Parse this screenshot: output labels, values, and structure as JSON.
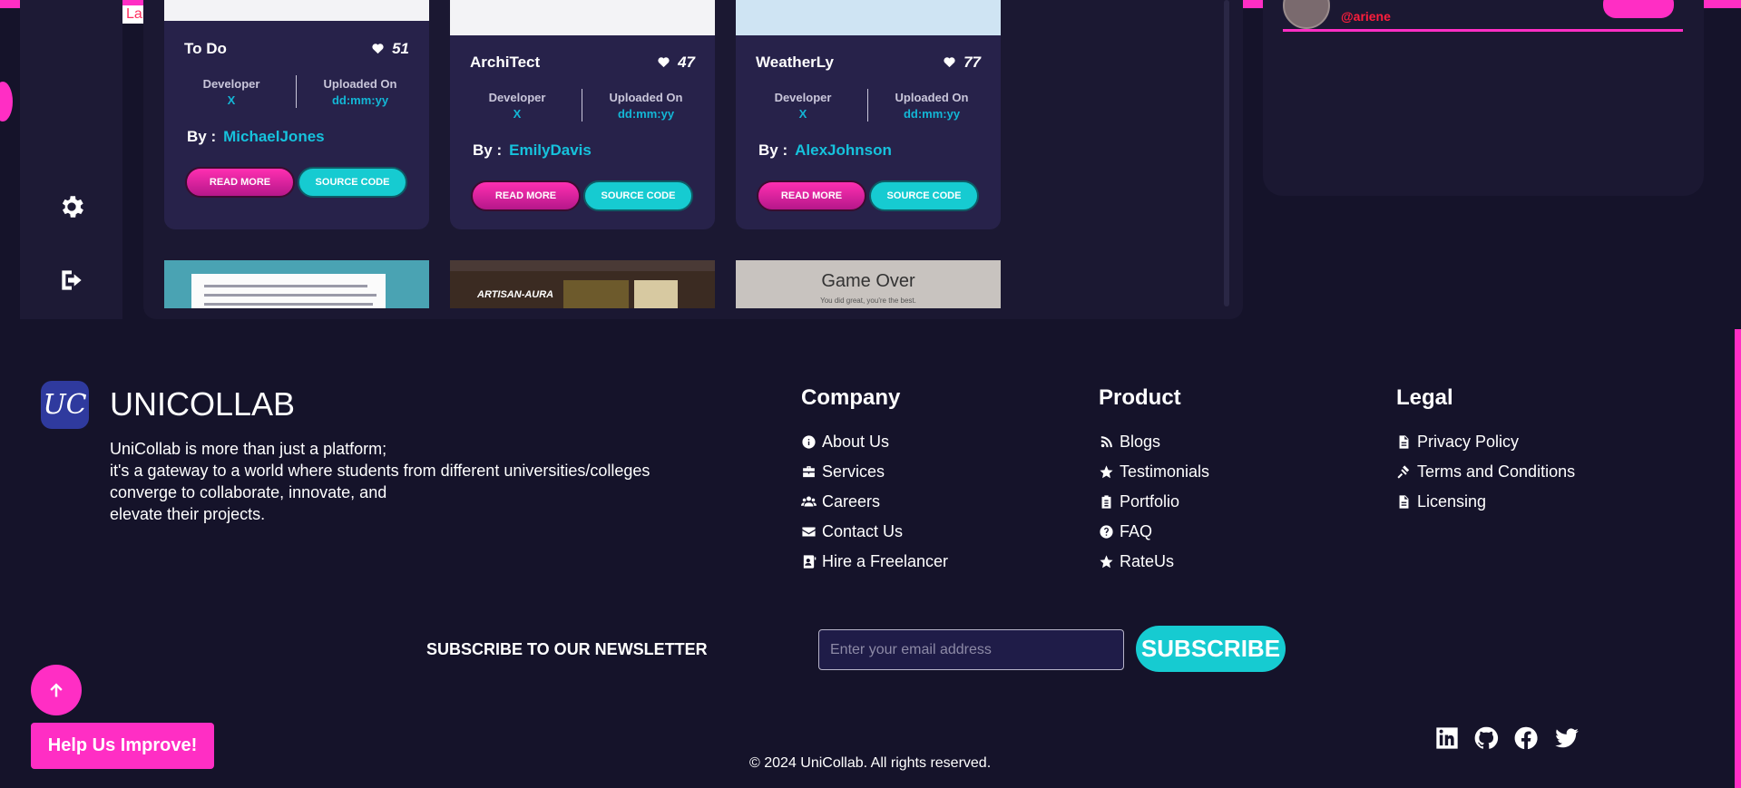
{
  "sidebar": {
    "logo_fragment": "Lar",
    "settings_icon": "gear-icon",
    "logout_icon": "logout-icon"
  },
  "cards": [
    {
      "title": "To Do",
      "likes": "51",
      "dev_label": "Developer",
      "dev_value": "X",
      "upload_label": "Uploaded On",
      "upload_value": "dd:mm:yy",
      "by_label": "By :",
      "author": "MichaelJones",
      "read_more": "READ MORE",
      "source_code": "SOURCE CODE"
    },
    {
      "title": "ArchiTect",
      "likes": "47",
      "dev_label": "Developer",
      "dev_value": "X",
      "upload_label": "Uploaded On",
      "upload_value": "dd:mm:yy",
      "by_label": "By :",
      "author": "EmilyDavis",
      "read_more": "READ MORE",
      "source_code": "SOURCE CODE"
    },
    {
      "title": "WeatherLy",
      "likes": "77",
      "dev_label": "Developer",
      "dev_value": "X",
      "upload_label": "Uploaded On",
      "upload_value": "dd:mm:yy",
      "by_label": "By :",
      "author": "AlexJohnson",
      "read_more": "READ MORE",
      "source_code": "SOURCE CODE"
    }
  ],
  "thumbnails": {
    "second_title": "ARTISAN-AURA",
    "third_title": "Game Over",
    "third_sub": "You did great, you're the best."
  },
  "user_panel": {
    "handle": "@ariene"
  },
  "footer": {
    "logo_text": "UC",
    "brand": "UNICOLLAB",
    "description": [
      "UniCollab is more than just a platform;",
      "it's a gateway to a world where students from different universities/colleges",
      "converge to collaborate, innovate, and",
      "elevate their projects."
    ],
    "company": {
      "heading": "Company",
      "links": [
        {
          "label": "About Us",
          "icon": "info-icon"
        },
        {
          "label": "Services",
          "icon": "briefcase-icon"
        },
        {
          "label": "Careers",
          "icon": "users-icon"
        },
        {
          "label": "Contact Us",
          "icon": "envelope-icon"
        },
        {
          "label": "Hire a Freelancer",
          "icon": "id-card-icon"
        }
      ]
    },
    "product": {
      "heading": "Product",
      "links": [
        {
          "label": "Blogs",
          "icon": "blog-icon"
        },
        {
          "label": "Testimonials",
          "icon": "star-icon"
        },
        {
          "label": "Portfolio",
          "icon": "clipboard-icon"
        },
        {
          "label": "FAQ",
          "icon": "question-icon"
        },
        {
          "label": "RateUs",
          "icon": "star-icon"
        }
      ]
    },
    "legal": {
      "heading": "Legal",
      "links": [
        {
          "label": "Privacy Policy",
          "icon": "document-icon"
        },
        {
          "label": "Terms and Conditions",
          "icon": "gavel-icon"
        },
        {
          "label": "Licensing",
          "icon": "document-icon"
        }
      ]
    },
    "newsletter": {
      "title": "SUBSCRIBE TO OUR NEWSLETTER",
      "placeholder": "Enter your email address",
      "button": "SUBSCRIBE"
    },
    "help_button": "Help Us Improve!",
    "copyright": "© 2024 UniCollab. All rights reserved.",
    "social": [
      "linkedin-icon",
      "github-icon",
      "facebook-icon",
      "twitter-icon"
    ]
  },
  "colors": {
    "accent_pink": "#ff2ec4",
    "accent_cyan": "#16cbd1",
    "background": "#15132a",
    "card": "#27224a"
  }
}
